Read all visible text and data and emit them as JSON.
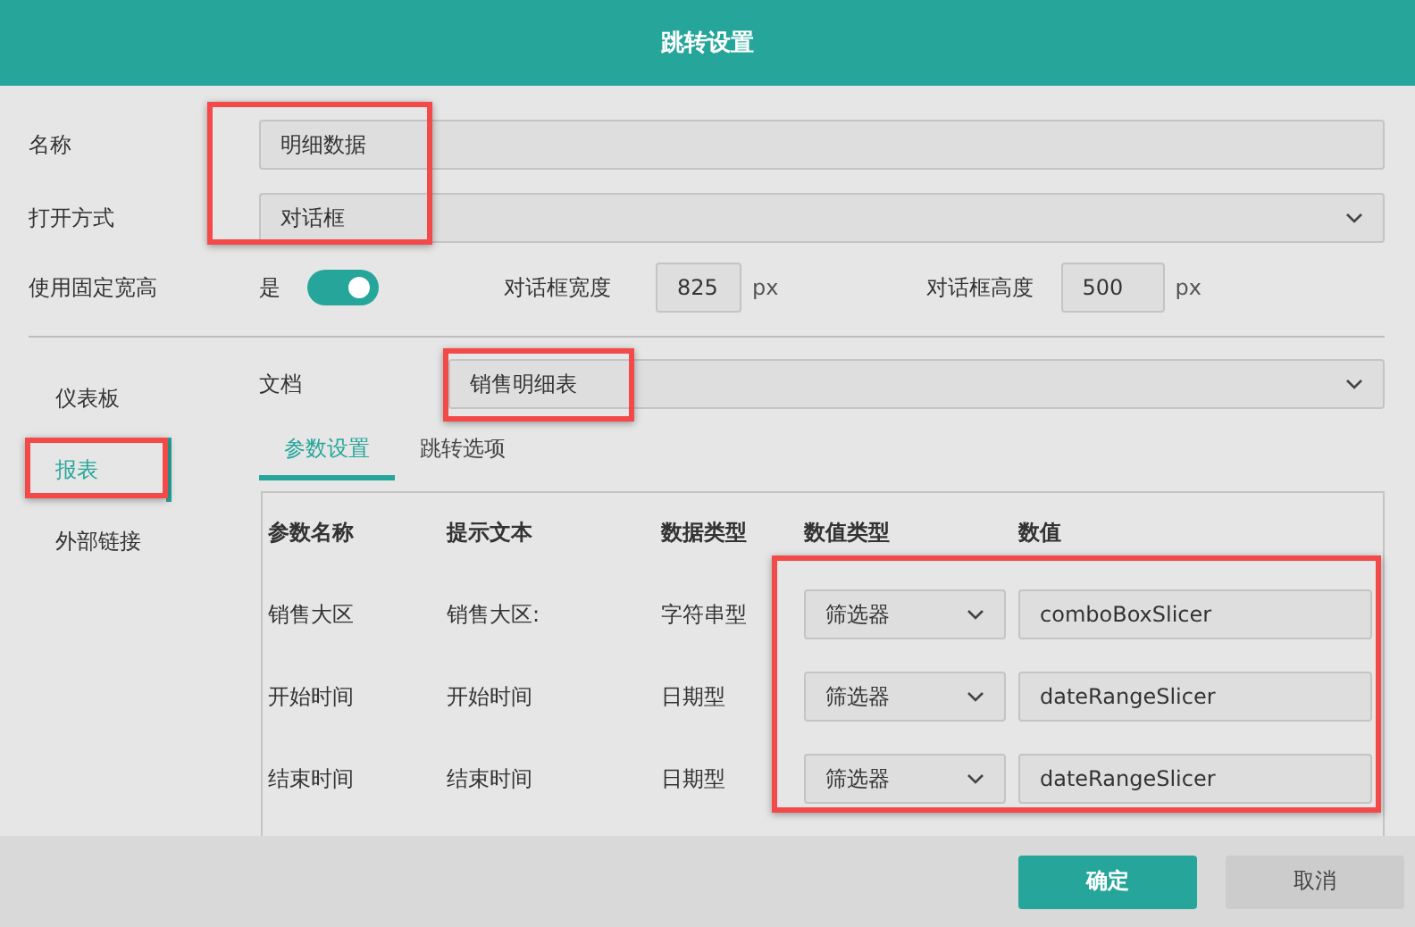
{
  "window": {
    "title": "跳转设置"
  },
  "form": {
    "highlighted": true,
    "name": {
      "label": "名称",
      "value": "明细数据"
    },
    "open_mode": {
      "label": "打开方式",
      "value": "对话框"
    }
  },
  "fixed_size": {
    "label": "使用固定宽高",
    "toggle_label": "是",
    "on": true,
    "width": {
      "label": "对话框宽度",
      "value": "825",
      "unit": "px"
    },
    "height": {
      "label": "对话框高度",
      "value": "500",
      "unit": "px"
    }
  },
  "sidebar": {
    "items": [
      {
        "label": "仪表板",
        "selected": false,
        "highlighted": false
      },
      {
        "label": "报表",
        "selected": true,
        "highlighted": true
      },
      {
        "label": "外部链接",
        "selected": false,
        "highlighted": false
      }
    ]
  },
  "document": {
    "label": "文档",
    "value": "销售明细表",
    "highlighted": true
  },
  "tabs": [
    {
      "label": "参数设置",
      "selected": true
    },
    {
      "label": "跳转选项",
      "selected": false
    }
  ],
  "params": {
    "columns": [
      "参数名称",
      "提示文本",
      "数据类型",
      "数值类型",
      "数值"
    ],
    "value_columns_highlighted": true,
    "rows": [
      {
        "name": "销售大区",
        "hint": "销售大区:",
        "data_type": "字符串型",
        "value_type": "筛选器",
        "value": "comboBoxSlicer"
      },
      {
        "name": "开始时间",
        "hint": "开始时间",
        "data_type": "日期型",
        "value_type": "筛选器",
        "value": "dateRangeSlicer"
      },
      {
        "name": "结束时间",
        "hint": "结束时间",
        "data_type": "日期型",
        "value_type": "筛选器",
        "value": "dateRangeSlicer"
      }
    ]
  },
  "buttons": [
    {
      "label": "确定",
      "kind": "primary"
    },
    {
      "label": "取消",
      "kind": "secondary"
    }
  ]
}
